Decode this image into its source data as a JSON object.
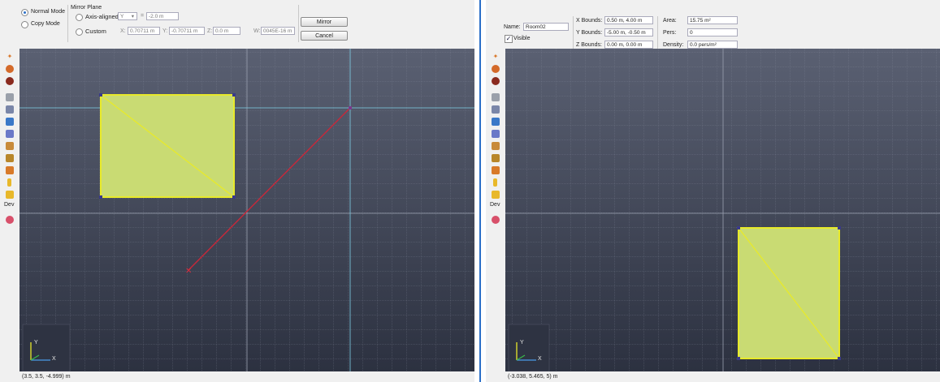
{
  "left": {
    "mode": {
      "normal_label": "Normal Mode",
      "copy_label": "Copy Mode",
      "selected": "Normal Mode"
    },
    "mirror_plane": {
      "title": "Mirror Plane",
      "axis_aligned_label": "Axis-aligned",
      "axis_value": "Y",
      "axis_arrow": "▾",
      "equals": "=",
      "axis_offset": "-2.0 m",
      "custom_label": "Custom",
      "x_label": "X:",
      "x_value": "0.70711 m",
      "y_label": "Y:",
      "y_value": "-0.70711 m",
      "z_label": "Z:",
      "z_value": "0.0 m",
      "w_label": "W:",
      "w_value": "0045E-16 m"
    },
    "buttons": {
      "mirror": "Mirror",
      "cancel": "Cancel"
    },
    "status": "(3.5, 3.5, -4.999) m"
  },
  "right": {
    "name_label": "Name:",
    "name_value": "Room02",
    "visible_label": "Visible",
    "visible_checked": "✓",
    "bounds": {
      "x_label": "X Bounds:",
      "x_value": "0.50 m, 4.00 m",
      "y_label": "Y Bounds:",
      "y_value": "-5.00 m, -0.50 m",
      "z_label": "Z Bounds:",
      "z_value": "0.00 m, 0.00 m"
    },
    "stats": {
      "area_label": "Area:",
      "area_value": "15.75 m²",
      "pers_label": "Pers:",
      "pers_value": "0",
      "density_label": "Density:",
      "density_value": "0.0 pers/m²"
    },
    "status": "(-3.038, 5.465, 5) m"
  },
  "sidebar": {
    "dev_label": "Dev"
  },
  "axis_gizmo": {
    "x_label": "X",
    "y_label": "Y"
  },
  "colors": {
    "canvas_top": "#5a6072",
    "canvas_bottom": "#2c3140",
    "room_fill": "#c9db73",
    "room_edge": "#e8ea2a",
    "mirror_line": "#7fd0e8",
    "drag_line": "#c8283a"
  }
}
